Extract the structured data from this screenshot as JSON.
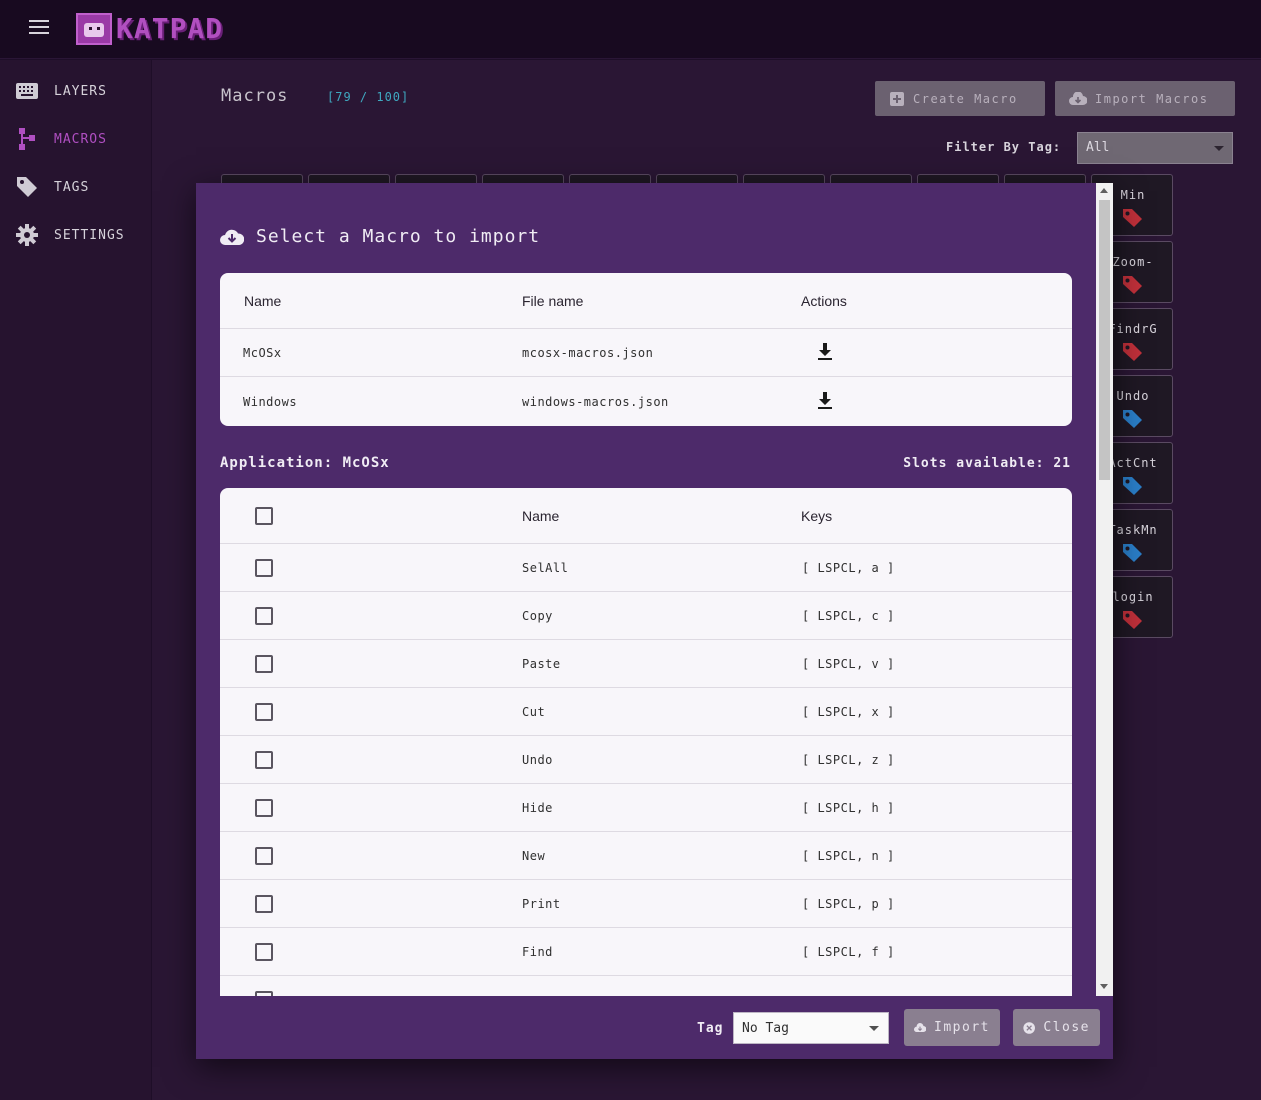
{
  "app": {
    "brand": "KATPAD"
  },
  "sidebar": {
    "items": [
      {
        "label": "LAYERS",
        "icon": "keyboard-icon",
        "active": false
      },
      {
        "label": "MACROS",
        "icon": "macros-icon",
        "active": true
      },
      {
        "label": "TAGS",
        "icon": "tag-icon",
        "active": false
      },
      {
        "label": "SETTINGS",
        "icon": "gear-icon",
        "active": false
      }
    ]
  },
  "page": {
    "title": "Macros",
    "count": "[79 / 100]",
    "create_label": "Create Macro",
    "import_label": "Import Macros",
    "filter_label": "Filter By Tag:",
    "filter_value": "All"
  },
  "tiles": [
    {
      "name": "Min",
      "tag_color": "#c0303a"
    },
    {
      "name": "Zoom-",
      "tag_color": "#c0303a"
    },
    {
      "name": "FindrG",
      "tag_color": "#c0303a"
    },
    {
      "name": "Undo",
      "tag_color": "#2a7ec8"
    },
    {
      "name": "ActCnt",
      "tag_color": "#2a7ec8"
    },
    {
      "name": "TaskMn",
      "tag_color": "#2a7ec8"
    },
    {
      "name": "login",
      "tag_color": "#c0303a"
    }
  ],
  "dialog": {
    "title": "Select a Macro to import",
    "files_table": {
      "headers": {
        "name": "Name",
        "file": "File name",
        "actions": "Actions"
      },
      "rows": [
        {
          "name": "McOSx",
          "file": "mcosx-macros.json"
        },
        {
          "name": "Windows",
          "file": "windows-macros.json"
        }
      ]
    },
    "application_label": "Application: McOSx",
    "slots_label": "Slots available: 21",
    "macros_table": {
      "headers": {
        "name": "Name",
        "keys": "Keys"
      },
      "rows": [
        {
          "name": "SelAll",
          "keys": "[ LSPCL, a ]"
        },
        {
          "name": "Copy",
          "keys": "[ LSPCL, c ]"
        },
        {
          "name": "Paste",
          "keys": "[ LSPCL, v ]"
        },
        {
          "name": "Cut",
          "keys": "[ LSPCL, x ]"
        },
        {
          "name": "Undo",
          "keys": "[ LSPCL, z ]"
        },
        {
          "name": "Hide",
          "keys": "[ LSPCL, h ]"
        },
        {
          "name": "New",
          "keys": "[ LSPCL, n ]"
        },
        {
          "name": "Print",
          "keys": "[ LSPCL, p ]"
        },
        {
          "name": "Find",
          "keys": "[ LSPCL, f ]"
        }
      ]
    },
    "footer": {
      "tag_label": "Tag",
      "tag_value": "No Tag",
      "import_label": "Import",
      "close_label": "Close"
    }
  }
}
